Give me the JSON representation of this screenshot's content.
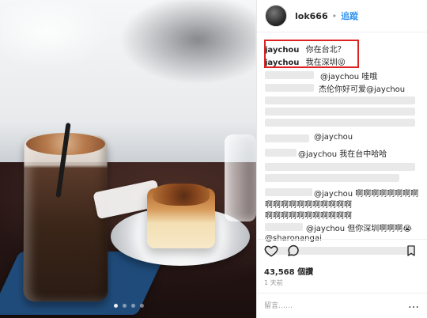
{
  "header": {
    "username": "lok666",
    "separator": "•",
    "follow": "追蹤"
  },
  "comments": {
    "top": [
      {
        "user": "jaychou",
        "text": "你在台北？"
      },
      {
        "user": "jaychou",
        "text": "我在深圳😜"
      }
    ],
    "lines": [
      {
        "text": "@jaychou 哇哦"
      },
      {
        "text": "杰伦你好可爱@jaychou"
      },
      {
        "text": "@jaychou"
      },
      {
        "text": "@jaychou 我在台中哈哈"
      },
      {
        "text": "@jaychou 啊啊啊啊啊啊啊啊"
      },
      {
        "text": "啊啊啊啊啊啊啊啊啊啊啊"
      },
      {
        "text": "啊啊啊啊啊啊啊啊啊啊啊"
      },
      {
        "text": "@jaychou 但你深圳啊啊啊😭"
      },
      {
        "text": "@sharonangai"
      }
    ]
  },
  "footer": {
    "likes": "43,568 個讚",
    "time": "1 天前",
    "comment_placeholder": "留言……",
    "more": "…"
  },
  "icons": {
    "heart": "heart-icon",
    "comment": "comment-icon",
    "bookmark": "bookmark-icon"
  },
  "colors": {
    "highlight": "#dd2222",
    "follow": "#3897f0"
  }
}
